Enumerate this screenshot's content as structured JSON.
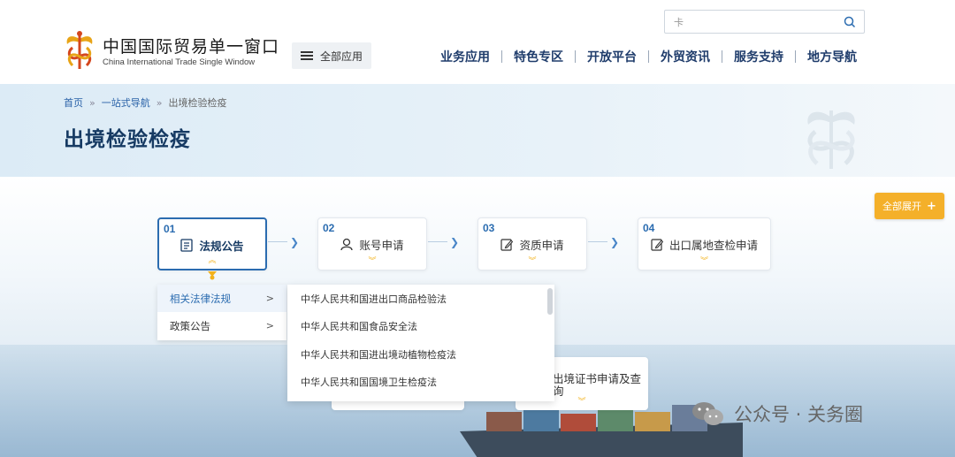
{
  "header": {
    "brand_cn": "中国国际贸易单一窗口",
    "brand_en": "China International Trade Single Window",
    "all_apps_label": "全部应用",
    "search_value": "卡",
    "nav": [
      "业务应用",
      "特色专区",
      "开放平台",
      "外贸资讯",
      "服务支持",
      "地方导航"
    ]
  },
  "banner": {
    "breadcrumb": [
      "首页",
      "一站式导航",
      "出境检验检疫"
    ],
    "breadcrumb_sep": "»",
    "title": "出境检验检疫"
  },
  "expand_all": {
    "label": "全部展开",
    "icon": "+"
  },
  "steps": [
    {
      "num": "01",
      "label": "法规公告",
      "icon": "document-icon"
    },
    {
      "num": "02",
      "label": "账号申请",
      "icon": "user-icon"
    },
    {
      "num": "03",
      "label": "资质申请",
      "icon": "edit-icon"
    },
    {
      "num": "04",
      "label": "出口属地查检申请",
      "icon": "edit-icon"
    }
  ],
  "submenu": [
    {
      "label": "相关法律法规",
      "arrow": ">"
    },
    {
      "label": "政策公告",
      "arrow": ">"
    }
  ],
  "laws": [
    "中华人民共和国进出口商品检验法",
    "中华人民共和国食品安全法",
    "中华人民共和国进出境动植物检疫法",
    "中华人民共和国国境卫生检疫法"
  ],
  "second_row": {
    "card_label": "出境证书申请及查询"
  },
  "watermark": {
    "text": "公众号 · 关务圈"
  },
  "colors": {
    "primary": "#2b6cb0",
    "nav_text": "#1f3c6b",
    "accent": "#f4b02a"
  }
}
